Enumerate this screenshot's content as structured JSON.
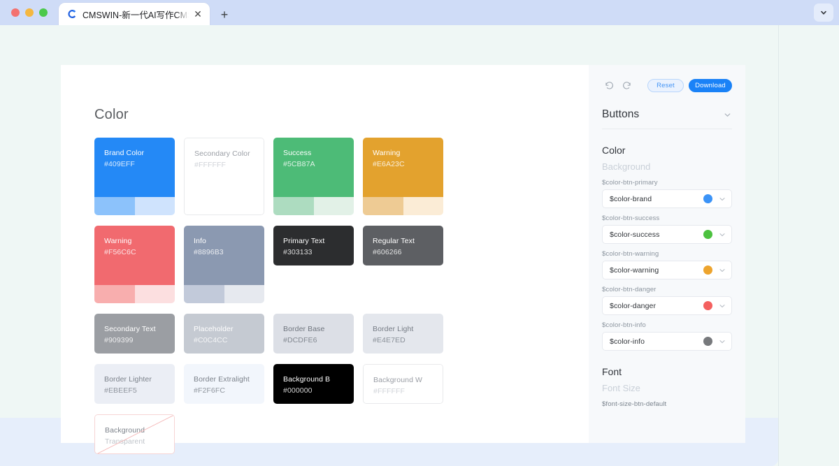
{
  "browser": {
    "tab_title": "CMSWIN-新一代AI写作CMS-智",
    "favicon": "cmswin-logo-icon",
    "close_label": "✕",
    "new_tab_label": "+",
    "tab_menu_icon": "chevron-down-icon"
  },
  "main": {
    "section_title": "Color",
    "swatches": [
      {
        "label": "Brand Color",
        "hex": "#409EFF",
        "bg": "#2489f6",
        "text": "#ffffff",
        "variants": [
          "#8cc2fb",
          "#cfe3fd"
        ],
        "style": "tall"
      },
      {
        "label": "Secondary Color",
        "hex": "#FFFFFF",
        "bg": "#ffffff",
        "text": "#9a9ea5",
        "hex_color": "#c6cad0",
        "style": "card-tall",
        "border": "light"
      },
      {
        "label": "Success",
        "hex": "#5CB87A",
        "bg": "#4dbb77",
        "text": "#ffffff",
        "variants": [
          "#addcc0",
          "#e2f1e7"
        ],
        "style": "tall"
      },
      {
        "label": "Warning",
        "hex": "#E6A23C",
        "bg": "#e3a22e",
        "text": "#ffffff",
        "variants": [
          "#eecb94",
          "#fbecd6"
        ],
        "style": "tall"
      },
      {
        "label": "Warning",
        "hex": "#F56C6C",
        "bg": "#f16a6f",
        "text": "#ffffff",
        "variants": [
          "#f8aeae",
          "#fcdfe0"
        ],
        "style": "tall"
      },
      {
        "label": "Info",
        "hex": "#8896B3",
        "bg": "#8b99b1",
        "text": "#ffffff",
        "variants": [
          "#c2cada",
          "#e6e9ef"
        ],
        "style": "tall"
      },
      {
        "label": "Primary Text",
        "hex": "#303133",
        "bg": "#2c2d2f",
        "text": "#ffffff",
        "style": "flat"
      },
      {
        "label": "Regular Text",
        "hex": "#606266",
        "bg": "#5d5f63",
        "text": "#ffffff",
        "style": "flat"
      },
      {
        "label": "Secondary Text",
        "hex": "#909399",
        "bg": "#9b9ea3",
        "text": "#ffffff",
        "style": "flat"
      },
      {
        "label": "Placeholder",
        "hex": "#C0C4CC",
        "bg": "#c5cad2",
        "text": "#ffffff",
        "style": "flat"
      },
      {
        "label": "Border Base",
        "hex": "#DCDFE6",
        "bg": "#dcdfe6",
        "text": "#6f757e",
        "style": "flat"
      },
      {
        "label": "Border Light",
        "hex": "#E4E7ED",
        "bg": "#e4e7ed",
        "text": "#767c85",
        "style": "flat"
      },
      {
        "label": "Border Lighter",
        "hex": "#EBEEF5",
        "bg": "#ebeef5",
        "text": "#7b818a",
        "style": "flat"
      },
      {
        "label": "Border Extralight",
        "hex": "#F2F6FC",
        "bg": "#f2f6fc",
        "text": "#7b818a",
        "style": "flat"
      },
      {
        "label": "Background B",
        "hex": "#000000",
        "bg": "#000000",
        "text": "#ffffff",
        "style": "bg-row"
      },
      {
        "label": "Background W",
        "hex": "#FFFFFF",
        "bg": "#ffffff",
        "text": "#9a9ea5",
        "hex_color": "#c6cad0",
        "style": "bg-row",
        "border": "light"
      },
      {
        "label": "Background",
        "hex": "Transparent",
        "bg": "#ffffff",
        "text": "#7d838b",
        "hex_color": "#b0b6bd",
        "style": "bg-row",
        "border": "pink",
        "diagonal": true,
        "diagonal_color": "#f4b6b6"
      }
    ]
  },
  "panel": {
    "toolbar": {
      "undo_icon": "undo-icon",
      "redo_icon": "redo-icon",
      "reset_label": "Reset",
      "download_label": "Download"
    },
    "section": {
      "title": "Buttons",
      "collapse_icon": "chevron-down-icon"
    },
    "color_group": {
      "title": "Color",
      "subtitle": "Background",
      "fields": [
        {
          "label": "$color-btn-primary",
          "value": "$color-brand",
          "dot": "#3b93f7"
        },
        {
          "label": "$color-btn-success",
          "value": "$color-success",
          "dot": "#4cc13f"
        },
        {
          "label": "$color-btn-warning",
          "value": "$color-warning",
          "dot": "#eda42e"
        },
        {
          "label": "$color-btn-danger",
          "value": "$color-danger",
          "dot": "#f4605f"
        },
        {
          "label": "$color-btn-info",
          "value": "$color-info",
          "dot": "#77797c"
        }
      ]
    },
    "font_group": {
      "title": "Font",
      "subtitle": "Font Size",
      "field_label": "$font-size-btn-default"
    }
  },
  "colors": {
    "page_bg": "#eff7f5",
    "bottom_band": "#e6eefb",
    "chrome_bg": "#cfdcf7",
    "accent": "#1a82f7"
  }
}
